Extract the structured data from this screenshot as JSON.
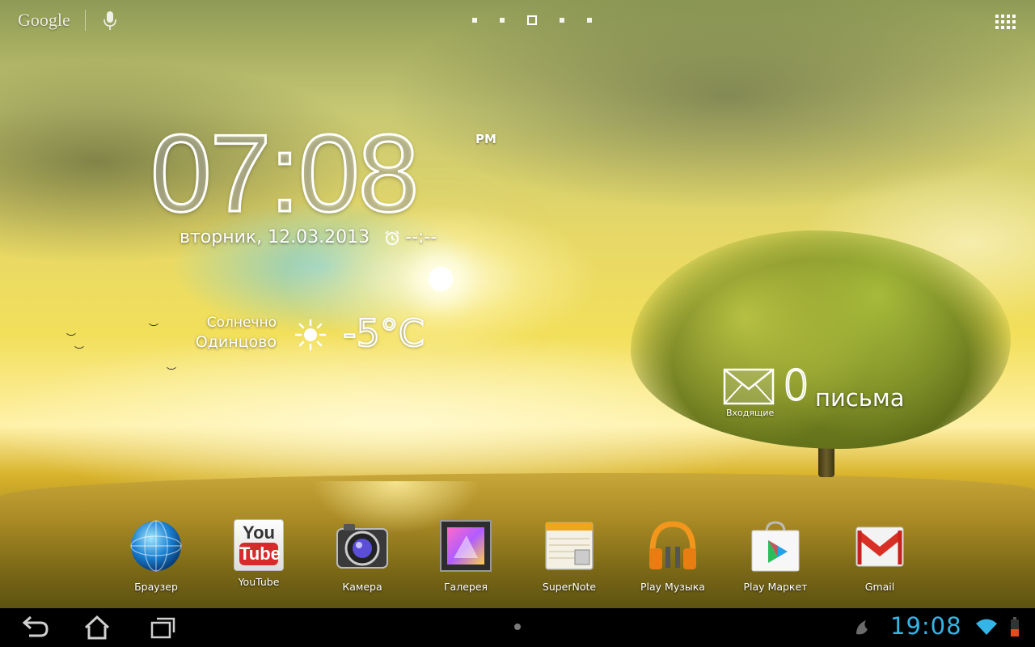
{
  "top_bar": {
    "search_logo": "Google"
  },
  "clock": {
    "time": "07:08",
    "ampm": "PM",
    "date": "вторник, 12.03.2013",
    "alarm": "--:--"
  },
  "weather": {
    "condition": "Солнечно",
    "city": "Одинцово",
    "temperature": "-5°C"
  },
  "mail": {
    "count": "0",
    "label": "письма",
    "inbox_label": "Входящие"
  },
  "dock": {
    "apps": [
      {
        "label": "Браузер",
        "icon": "globe-icon"
      },
      {
        "label": "YouTube",
        "icon": "youtube-icon",
        "icon_text_1": "You",
        "icon_text_2": "Tube"
      },
      {
        "label": "Камера",
        "icon": "camera-icon"
      },
      {
        "label": "Галерея",
        "icon": "gallery-icon"
      },
      {
        "label": "SuperNote",
        "icon": "notebook-icon"
      },
      {
        "label": "Play Музыка",
        "icon": "headphones-icon"
      },
      {
        "label": "Play Маркет",
        "icon": "shopping-bag-icon"
      },
      {
        "label": "Gmail",
        "icon": "gmail-envelope-icon"
      }
    ]
  },
  "status_bar": {
    "time": "19:08",
    "accent": "#35b5e5"
  }
}
